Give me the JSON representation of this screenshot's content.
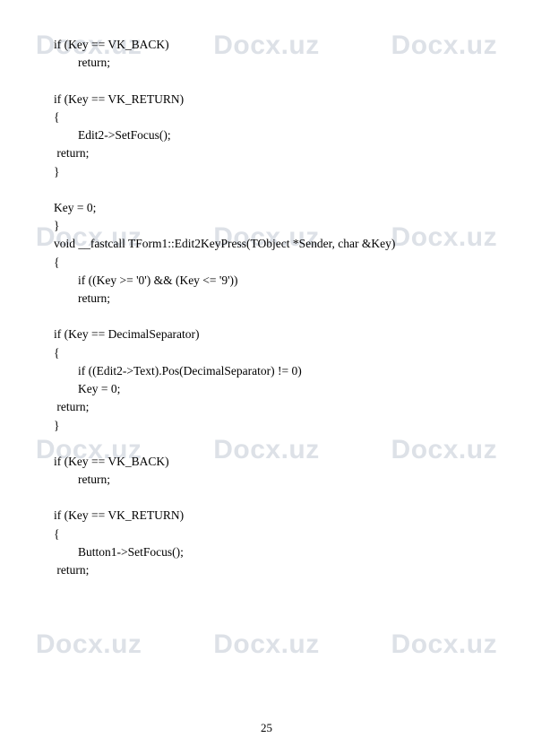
{
  "watermark": "Docx.uz",
  "watermark_rows": [
    34,
    248,
    485,
    702
  ],
  "page_number": "25",
  "code_lines": [
    "if (Key == VK_BACK)",
    "        return;",
    "",
    "if (Key == VK_RETURN)",
    "{",
    "        Edit2->SetFocus();",
    " return;",
    "}",
    "",
    "Key = 0;",
    "}",
    "void __fastcall TForm1::Edit2KeyPress(TObject *Sender, char &Key)",
    "{",
    "        if ((Key >= '0') && (Key <= '9'))",
    "        return;",
    "",
    "if (Key == DecimalSeparator)",
    "{",
    "        if ((Edit2->Text).Pos(DecimalSeparator) != 0)",
    "        Key = 0;",
    " return;",
    "}",
    "",
    "if (Key == VK_BACK)",
    "        return;",
    "",
    "if (Key == VK_RETURN)",
    "{",
    "        Button1->SetFocus();",
    " return;"
  ]
}
